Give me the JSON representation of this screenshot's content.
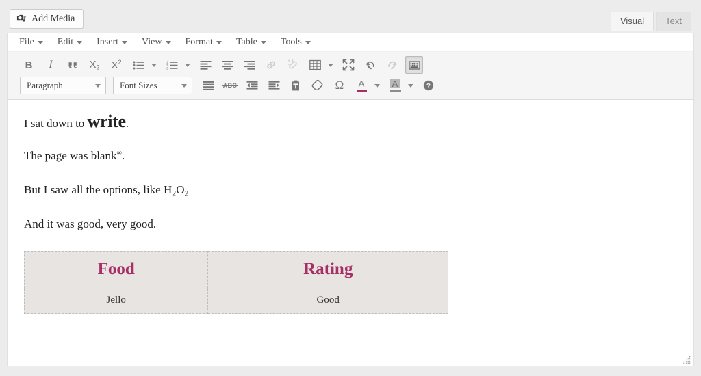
{
  "topbar": {
    "add_media_label": "Add Media",
    "add_media_icon": "camera-media-icon",
    "tabs": [
      {
        "label": "Visual",
        "active": true
      },
      {
        "label": "Text",
        "active": false
      }
    ]
  },
  "menubar": {
    "items": [
      {
        "label": "File"
      },
      {
        "label": "Edit"
      },
      {
        "label": "Insert"
      },
      {
        "label": "View"
      },
      {
        "label": "Format"
      },
      {
        "label": "Table"
      },
      {
        "label": "Tools"
      }
    ]
  },
  "toolbar_row1": {
    "buttons": [
      {
        "name": "bold-button",
        "title": "Bold",
        "glyph": "B"
      },
      {
        "name": "italic-button",
        "title": "Italic",
        "glyph": "I"
      },
      {
        "name": "blockquote-button",
        "title": "Blockquote",
        "glyph": "“"
      },
      {
        "name": "subscript-button",
        "title": "Subscript",
        "glyph": "X2"
      },
      {
        "name": "superscript-button",
        "title": "Superscript",
        "glyph": "X2"
      },
      {
        "name": "bullet-list-button",
        "title": "Bulleted list",
        "glyph": "bullet-list-icon"
      },
      {
        "name": "numbered-list-button",
        "title": "Numbered list",
        "glyph": "numbered-list-icon"
      },
      {
        "name": "align-left-button",
        "title": "Align left",
        "glyph": "align-left-icon"
      },
      {
        "name": "align-center-button",
        "title": "Align center",
        "glyph": "align-center-icon"
      },
      {
        "name": "align-right-button",
        "title": "Align right",
        "glyph": "align-right-icon"
      },
      {
        "name": "insert-link-button",
        "title": "Insert/edit link",
        "glyph": "link-icon"
      },
      {
        "name": "remove-link-button",
        "title": "Remove link",
        "glyph": "unlink-icon"
      },
      {
        "name": "table-button",
        "title": "Table",
        "glyph": "table-icon"
      },
      {
        "name": "fullscreen-button",
        "title": "Fullscreen",
        "glyph": "fullscreen-icon"
      },
      {
        "name": "undo-button",
        "title": "Undo",
        "glyph": "undo-icon"
      },
      {
        "name": "redo-button",
        "title": "Redo",
        "glyph": "redo-icon"
      },
      {
        "name": "toggle-toolbar-button",
        "title": "Toolbar Toggle",
        "glyph": "keyboard-icon"
      }
    ]
  },
  "toolbar_row2": {
    "paragraph_select": "Paragraph",
    "fontsize_select": "Font Sizes",
    "buttons": [
      {
        "name": "justify-button",
        "title": "Justify",
        "glyph": "justify-icon"
      },
      {
        "name": "strikethrough-button",
        "title": "Strikethrough",
        "glyph": "ABC"
      },
      {
        "name": "outdent-button",
        "title": "Decrease indent",
        "glyph": "outdent-icon"
      },
      {
        "name": "indent-button",
        "title": "Increase indent",
        "glyph": "indent-icon"
      },
      {
        "name": "paste-as-text-button",
        "title": "Paste as text",
        "glyph": "clipboard-icon"
      },
      {
        "name": "clear-formatting-button",
        "title": "Clear formatting",
        "glyph": "eraser-icon"
      },
      {
        "name": "special-character-button",
        "title": "Special character",
        "glyph": "Ω"
      },
      {
        "name": "text-color-button",
        "title": "Text color",
        "glyph": "A"
      },
      {
        "name": "background-color-button",
        "title": "Background color",
        "glyph": "A"
      },
      {
        "name": "keyboard-shortcuts-button",
        "title": "Keyboard Shortcuts",
        "glyph": "help-icon"
      }
    ],
    "text_color": "#a82f66",
    "background_color": "#b0b0b0"
  },
  "content": {
    "paragraph1_prefix": "I sat down to ",
    "paragraph1_bold": "write",
    "paragraph1_suffix": ".",
    "paragraph2_prefix": "The page was blank",
    "paragraph2_sup": "∞",
    "paragraph2_suffix": ".",
    "paragraph3_prefix": "But I saw all the options, like H",
    "paragraph3_sub1": "2",
    "paragraph3_mid": "O",
    "paragraph3_sub2": "2",
    "paragraph4": "And it was good, very good.",
    "table": {
      "headers": [
        "Food",
        "Rating"
      ],
      "rows": [
        [
          "Jello",
          "Good"
        ]
      ],
      "header_color": "#a82f66",
      "cell_background": "#e7e4e2",
      "outer_border_color": "#d6c77e",
      "inner_border_color": "#bdbdbd"
    }
  },
  "statusbar": {
    "resize_handle": "resize-grip-icon"
  }
}
